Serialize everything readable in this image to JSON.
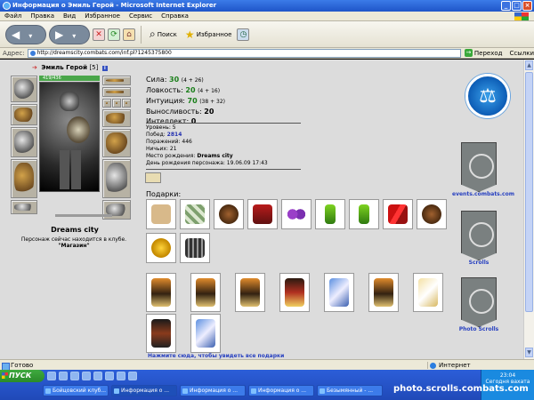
{
  "window": {
    "title": "Информация о Эмиль Герой - Microsoft Internet Explorer"
  },
  "menu": [
    "Файл",
    "Правка",
    "Вид",
    "Избранное",
    "Сервис",
    "Справка"
  ],
  "toolbar": {
    "search_label": "Поиск",
    "favorites_label": "Избранное"
  },
  "address": {
    "label": "Адрес:",
    "url": "http://dreamscity.combats.com/inf.pl?1245375800",
    "go_label": "Переход",
    "links_label": "Ссылки"
  },
  "character": {
    "name": "Эмиль Герой",
    "level": "[5]",
    "hp": "419/436",
    "city": "Dreams city",
    "club_text": "Персонаж сейчас находится в клубе.",
    "club_location": "\"Магазин\""
  },
  "stats": [
    {
      "label": "Сила:",
      "value": "30",
      "bonus": "(4 + 26)",
      "green": true
    },
    {
      "label": "Ловкость:",
      "value": "20",
      "bonus": "(4 + 16)",
      "green": true
    },
    {
      "label": "Интуиция:",
      "value": "70",
      "bonus": "(38 + 32)",
      "green": true
    },
    {
      "label": "Выносливость:",
      "value": "20",
      "bonus": "",
      "green": false
    },
    {
      "label": "Интеллект:",
      "value": "0",
      "bonus": "",
      "green": false
    }
  ],
  "info": {
    "level": "Уровень: 5",
    "wins_label": "Побед:",
    "wins": "2814",
    "losses": "Поражений: 446",
    "draws": "Ничьих: 21",
    "birthplace_label": "Место рождения:",
    "birthplace": "Dreams city",
    "birthday": "День рождения персонажа: 19.06.09 17:43"
  },
  "gifts": {
    "label": "Подарки:",
    "footer": "Нажмите сюда, чтобы увидеть все подарки"
  },
  "sidebar": {
    "events_link": "events.combats.com",
    "scrolls_link": "Scrolls",
    "photo_link": "Photo Scrolls"
  },
  "status": {
    "text": "Готово",
    "zone": "Интернет"
  },
  "taskbar": {
    "start": "ПУСК",
    "tasks": [
      "Бойцовский клуб...",
      "Информация о ...",
      "Информация о ...",
      "Информация о ...",
      "Безымянный - ..."
    ],
    "time": "23:04",
    "tray_text": "Сегодня вахата"
  },
  "watermark": "photo.scrolls.combats.com"
}
